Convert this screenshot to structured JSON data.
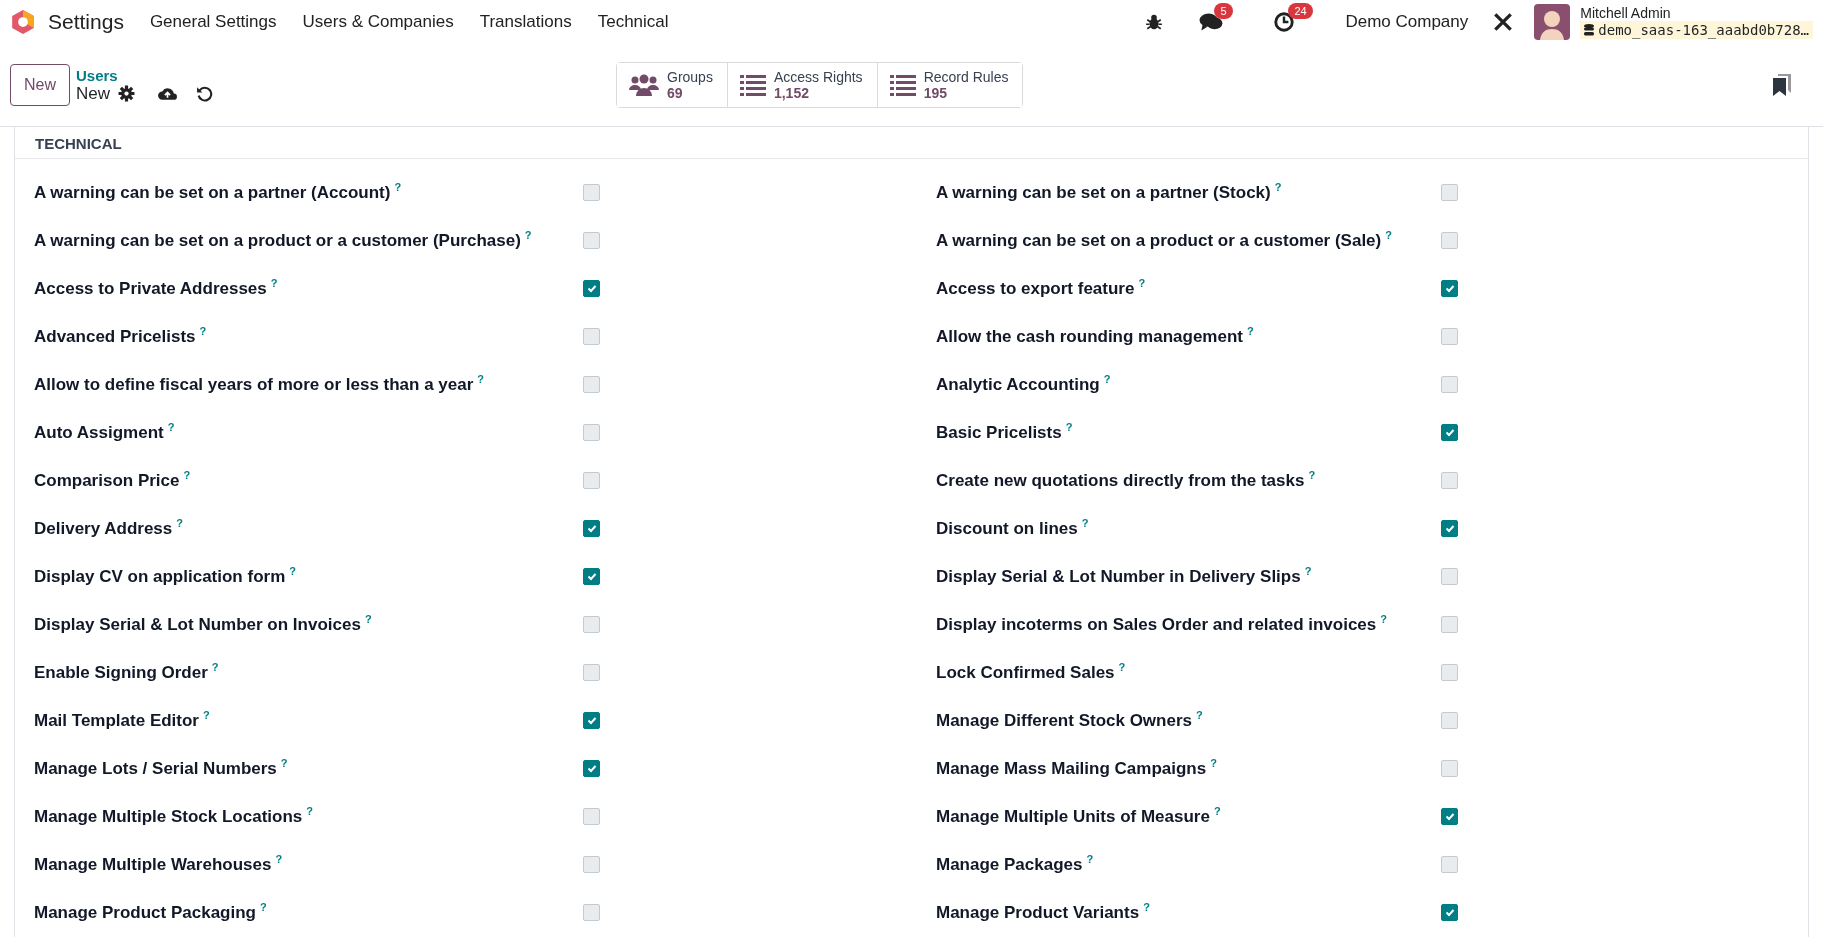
{
  "navbar": {
    "app_name": "Settings",
    "menu": [
      "General Settings",
      "Users & Companies",
      "Translations",
      "Technical"
    ],
    "messages_badge": "5",
    "activities_badge": "24",
    "company": "Demo Company",
    "user_name": "Mitchell Admin",
    "database": "demo_saas-163_aaabd0b728…"
  },
  "control_panel": {
    "new_button": "New",
    "breadcrumb": "Users",
    "record_title": "New",
    "stat_buttons": [
      {
        "kind": "groups",
        "label": "Groups",
        "value": "69"
      },
      {
        "kind": "list",
        "label": "Access Rights",
        "value": "1,152"
      },
      {
        "kind": "list",
        "label": "Record Rules",
        "value": "195"
      }
    ]
  },
  "section": {
    "title": "TECHNICAL",
    "settings": [
      {
        "label": "A warning can be set on a partner (Account)",
        "help": "?",
        "checked": false
      },
      {
        "label": "A warning can be set on a partner (Stock)",
        "help": "?",
        "checked": false
      },
      {
        "label": "A warning can be set on a product or a customer (Purchase)",
        "help": "?",
        "checked": false
      },
      {
        "label": "A warning can be set on a product or a customer (Sale)",
        "help": "?",
        "checked": false
      },
      {
        "label": "Access to Private Addresses",
        "help": "?",
        "checked": true
      },
      {
        "label": "Access to export feature",
        "help": "?",
        "checked": true
      },
      {
        "label": "Advanced Pricelists",
        "help": "?",
        "checked": false
      },
      {
        "label": "Allow the cash rounding management",
        "help": "?",
        "checked": false
      },
      {
        "label": "Allow to define fiscal years of more or less than a year",
        "help": "?",
        "checked": false
      },
      {
        "label": "Analytic Accounting",
        "help": "?",
        "checked": false
      },
      {
        "label": "Auto Assigment",
        "help": "?",
        "checked": false
      },
      {
        "label": "Basic Pricelists",
        "help": "?",
        "checked": true
      },
      {
        "label": "Comparison Price",
        "help": "?",
        "checked": false
      },
      {
        "label": "Create new quotations directly from the tasks",
        "help": "?",
        "checked": false
      },
      {
        "label": "Delivery Address",
        "help": "?",
        "checked": true
      },
      {
        "label": "Discount on lines",
        "help": "?",
        "checked": true
      },
      {
        "label": "Display CV on application form",
        "help": "?",
        "checked": true
      },
      {
        "label": "Display Serial & Lot Number in Delivery Slips",
        "help": "?",
        "checked": false
      },
      {
        "label": "Display Serial & Lot Number on Invoices",
        "help": "?",
        "checked": false
      },
      {
        "label": "Display incoterms on Sales Order and related invoices",
        "help": "?",
        "checked": false
      },
      {
        "label": "Enable Signing Order",
        "help": "?",
        "checked": false
      },
      {
        "label": "Lock Confirmed Sales",
        "help": "?",
        "checked": false
      },
      {
        "label": "Mail Template Editor",
        "help": "?",
        "checked": true
      },
      {
        "label": "Manage Different Stock Owners",
        "help": "?",
        "checked": false
      },
      {
        "label": "Manage Lots / Serial Numbers",
        "help": "?",
        "checked": true
      },
      {
        "label": "Manage Mass Mailing Campaigns",
        "help": "?",
        "checked": false
      },
      {
        "label": "Manage Multiple Stock Locations",
        "help": "?",
        "checked": false
      },
      {
        "label": "Manage Multiple Units of Measure",
        "help": "?",
        "checked": true
      },
      {
        "label": "Manage Multiple Warehouses",
        "help": "?",
        "checked": false
      },
      {
        "label": "Manage Packages",
        "help": "?",
        "checked": false
      },
      {
        "label": "Manage Product Packaging",
        "help": "?",
        "checked": false
      },
      {
        "label": "Manage Product Variants",
        "help": "?",
        "checked": true
      }
    ]
  }
}
